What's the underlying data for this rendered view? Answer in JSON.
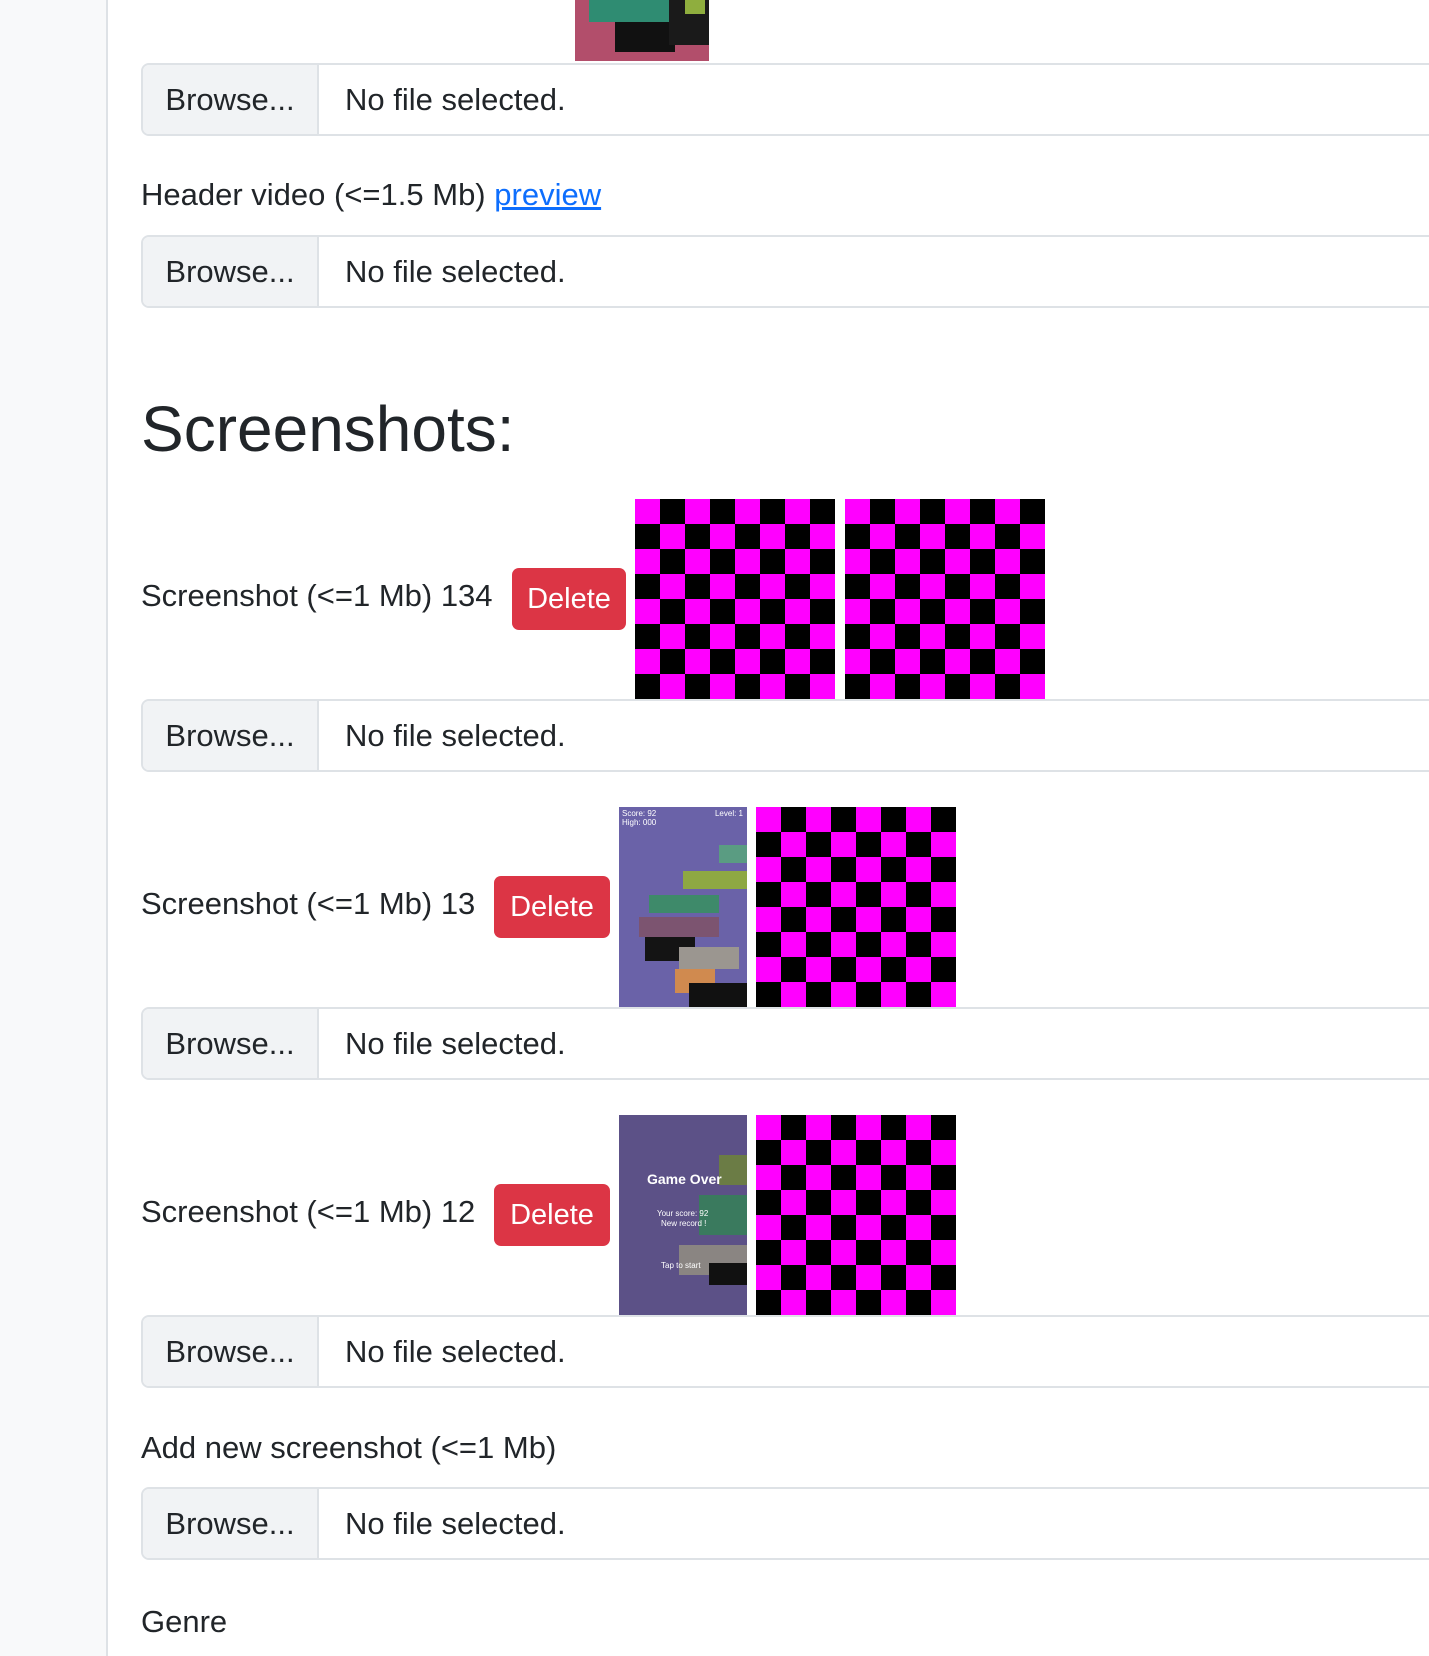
{
  "file_input": {
    "browse_label": "Browse...",
    "status": "No file selected."
  },
  "header_video": {
    "label": "Header video (<=1.5 Mb)",
    "preview_link": "preview"
  },
  "screenshots": {
    "heading": "Screenshots:",
    "items": [
      {
        "label": "Screenshot (<=1 Mb) 134",
        "delete_label": "Delete"
      },
      {
        "label": "Screenshot (<=1 Mb) 13",
        "delete_label": "Delete",
        "thumb_score": "Score: 92",
        "thumb_high": "High: 000",
        "thumb_level": "Level: 1"
      },
      {
        "label": "Screenshot (<=1 Mb) 12",
        "delete_label": "Delete",
        "thumb_title": "Game Over",
        "thumb_score": "Your score: 92",
        "thumb_record": "New record !",
        "thumb_start": "Tap to start"
      }
    ],
    "add_new_label": "Add new screenshot (<=1 Mb)"
  },
  "genre_label": "Genre",
  "colors": {
    "delete_button": "#dc3545",
    "link": "#0d6efd",
    "checker_pink": "#ff00ff"
  }
}
